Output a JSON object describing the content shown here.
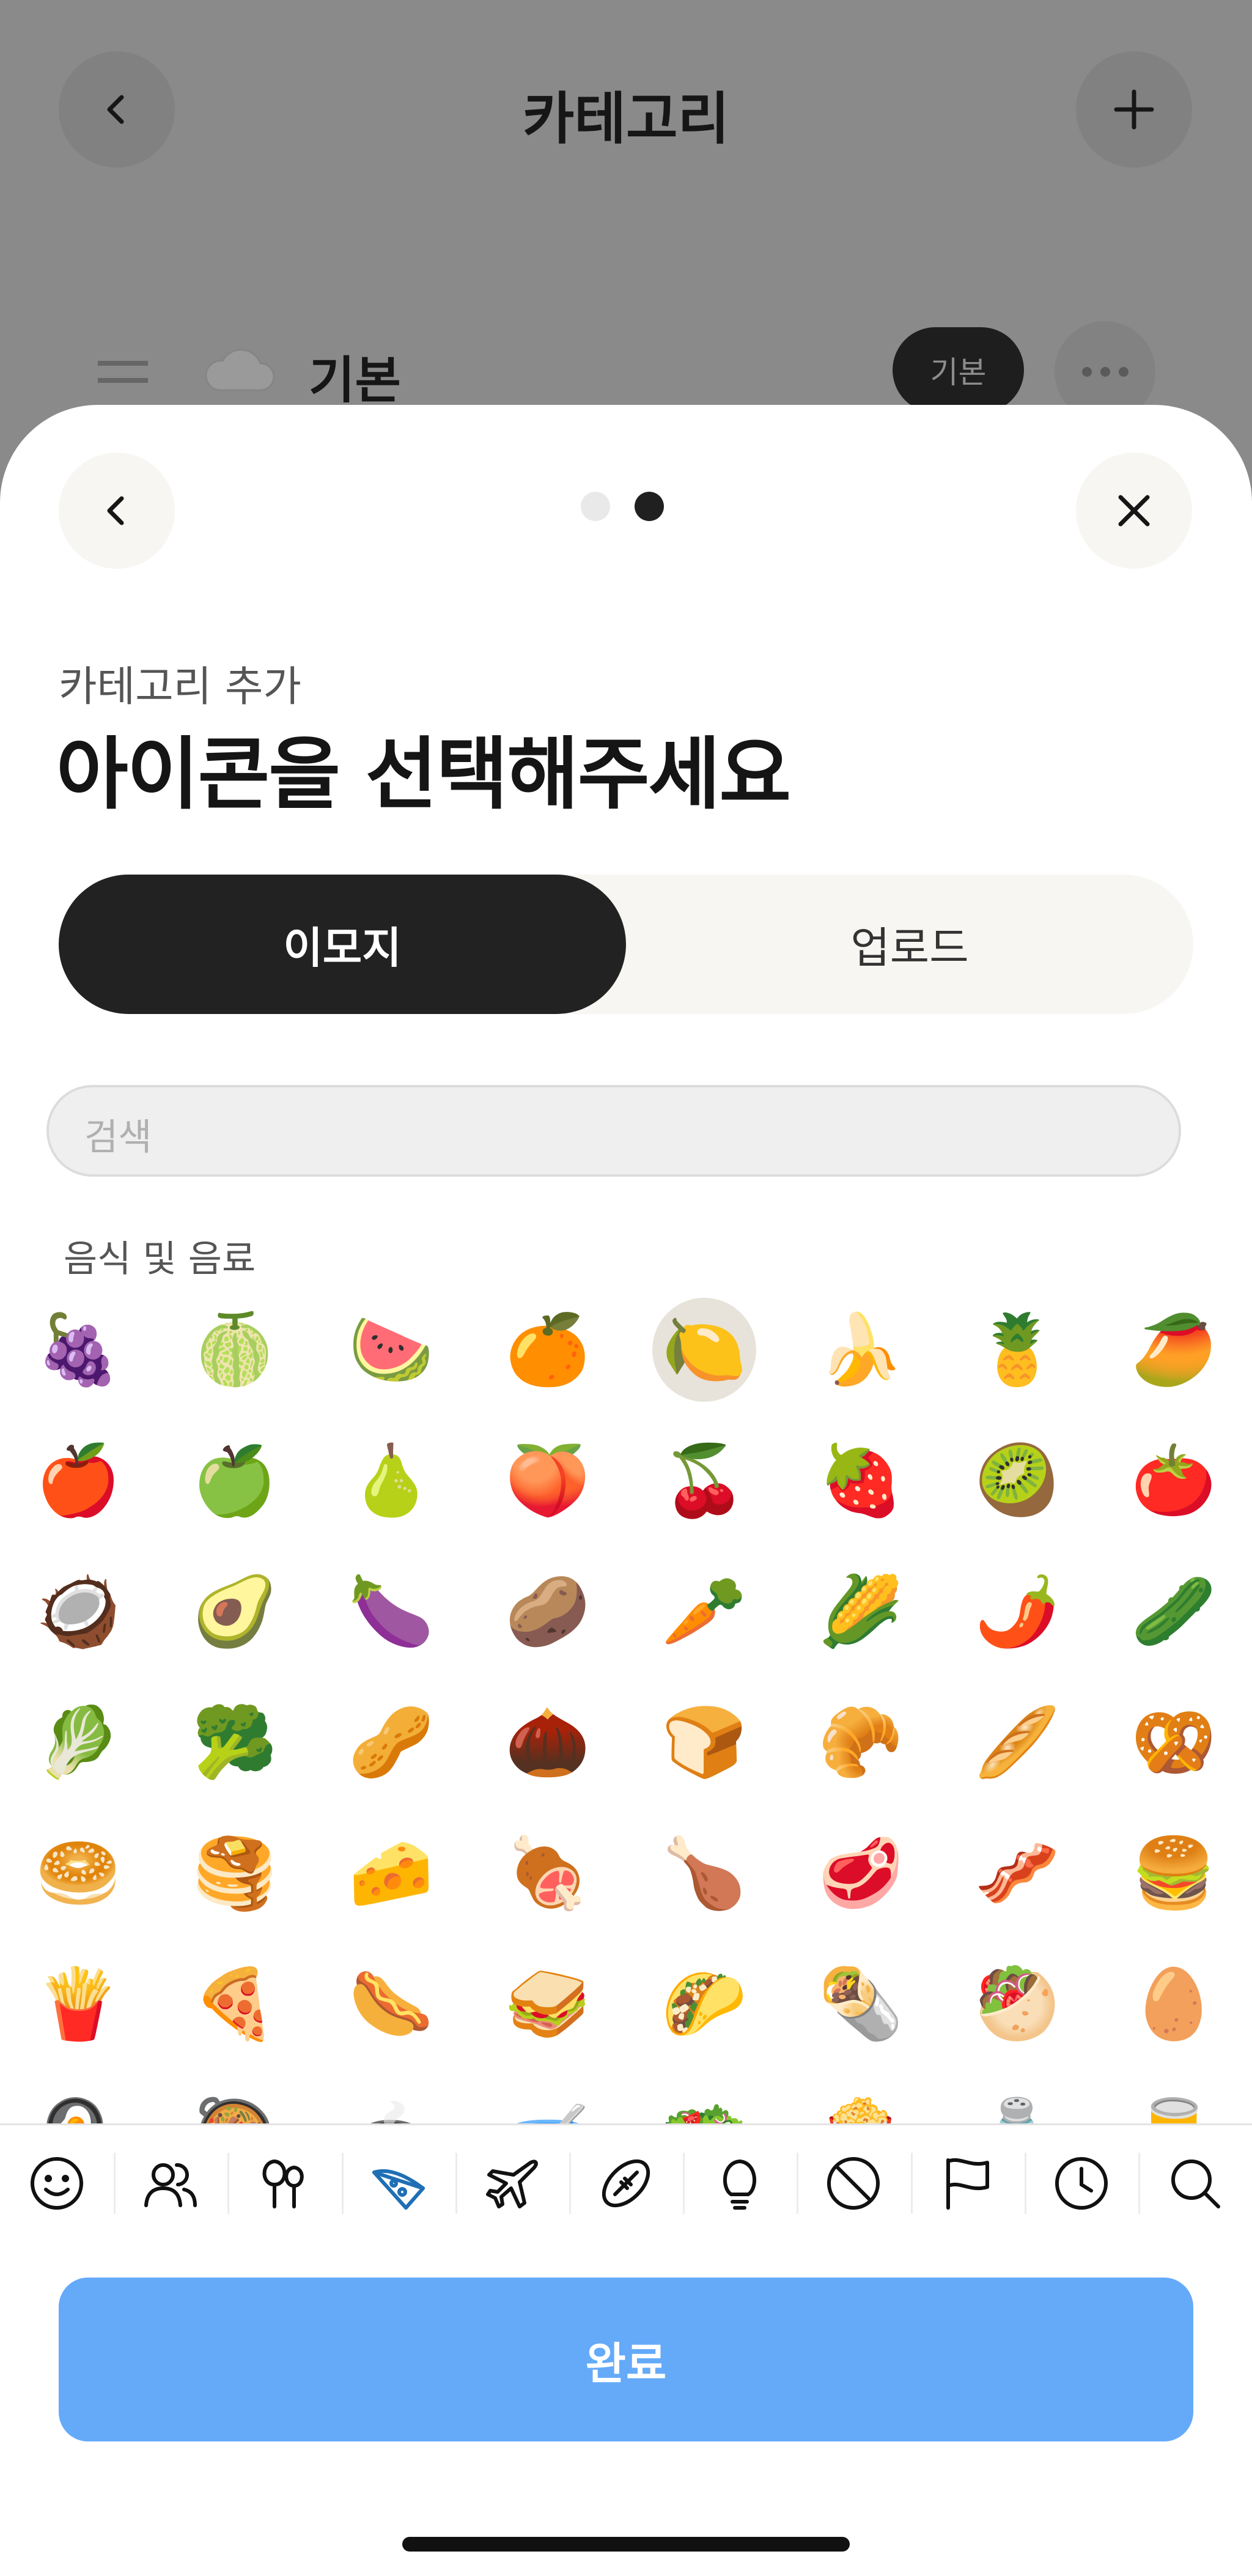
{
  "background_page": {
    "title": "카테고리",
    "row": {
      "label": "기본",
      "badge": "기본"
    }
  },
  "sheet": {
    "subtitle": "카테고리 추가",
    "title": "아이콘을 선택해주세요",
    "pager": {
      "pages": 2,
      "current": 2
    },
    "tabs": [
      "이모지",
      "업로드"
    ],
    "search": {
      "placeholder": "검색",
      "value": ""
    },
    "section_label": "음식 및 음료",
    "selected_emoji": "🍋",
    "emoji_rows": [
      [
        "🍇",
        "🍈",
        "🍉",
        "🍊",
        "🍋",
        "🍌",
        "🍍",
        "🥭"
      ],
      [
        "🍎",
        "🍏",
        "🍐",
        "🍑",
        "🍒",
        "🍓",
        "🥝",
        "🍅"
      ],
      [
        "🥥",
        "🥑",
        "🍆",
        "🥔",
        "🥕",
        "🌽",
        "🌶️",
        "🥒"
      ],
      [
        "🥬",
        "🥦",
        "🥜",
        "🌰",
        "🍞",
        "🥐",
        "🥖",
        "🥨"
      ],
      [
        "🥯",
        "🥞",
        "🧀",
        "🍖",
        "🍗",
        "🥩",
        "🥓",
        "🍔"
      ],
      [
        "🍟",
        "🍕",
        "🌭",
        "🥪",
        "🌮",
        "🌯",
        "🥙",
        "🥚"
      ],
      [
        "🍳",
        "🥘",
        "🍲",
        "🥣",
        "🥗",
        "🍿",
        "🧂",
        "🥫"
      ]
    ],
    "category_tabs": [
      "smiley-icon",
      "people-icon",
      "nature-icon",
      "food-icon",
      "travel-icon",
      "activity-icon",
      "objects-icon",
      "symbols-icon",
      "flags-icon",
      "recent-icon",
      "search-icon"
    ],
    "active_category": "food-icon",
    "done_label": "완료",
    "colors": {
      "accent": "#64aaf9",
      "dark": "#222222",
      "active_category": "#1f6fb5"
    }
  }
}
